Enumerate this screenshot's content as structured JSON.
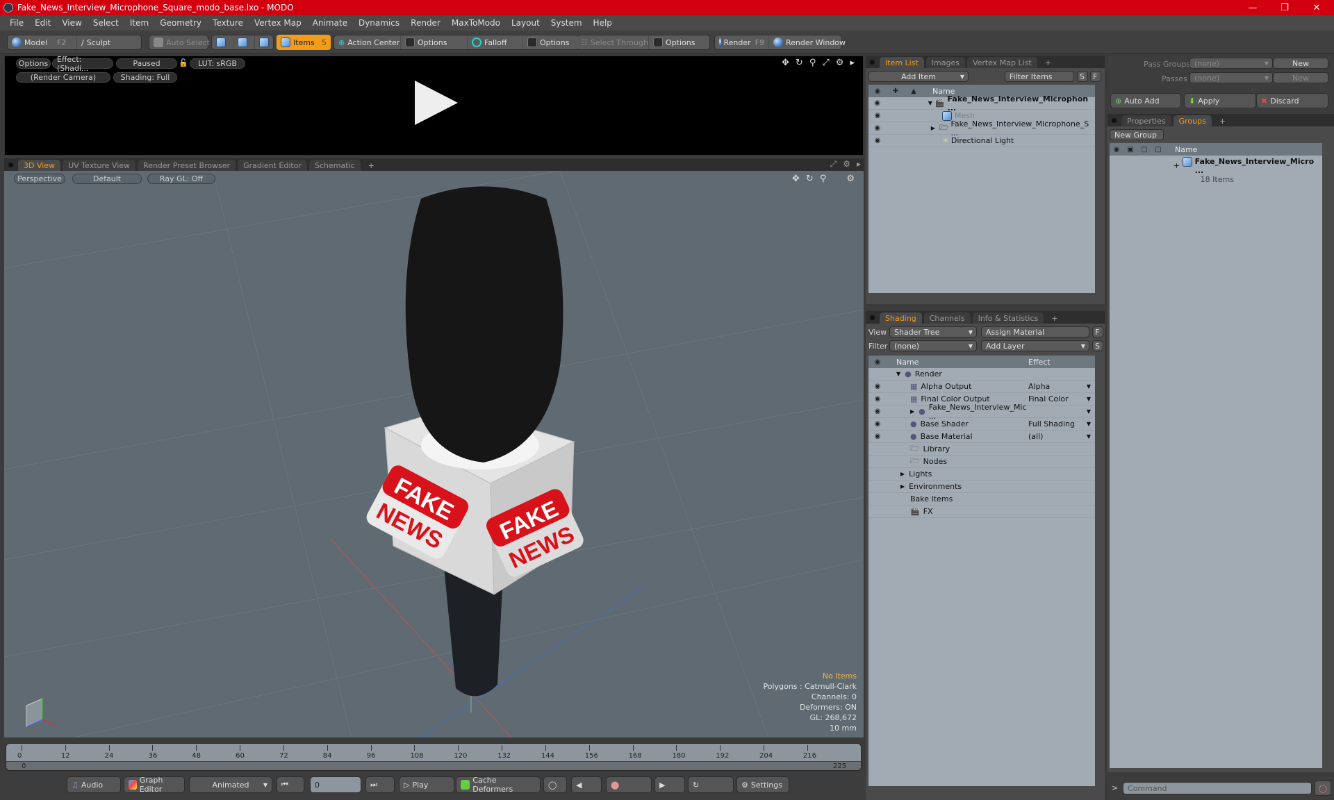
{
  "window": {
    "title": "Fake_News_Interview_Microphone_Square_modo_base.lxo - MODO",
    "accent": "#d2000f"
  },
  "menu": [
    "File",
    "Edit",
    "View",
    "Select",
    "Item",
    "Geometry",
    "Texture",
    "Vertex Map",
    "Animate",
    "Dynamics",
    "Render",
    "MaxToModo",
    "Layout",
    "System",
    "Help"
  ],
  "toolbar": {
    "model": "Model",
    "model_key": "F2",
    "sculpt": "Sculpt",
    "auto_select": "Auto Select",
    "items": "Items",
    "items_key": "5",
    "action_center": "Action Center",
    "options1": "Options",
    "falloff": "Falloff",
    "options2": "Options",
    "select_through": "Select Through",
    "options3": "Options",
    "render": "Render",
    "render_key": "F9",
    "render_window": "Render Window"
  },
  "preview": {
    "options": "Options",
    "effect": "Effect: (Shadi...",
    "status": "Paused",
    "lut": "LUT: sRGB",
    "camera": "(Render Camera)",
    "shading": "Shading: Full"
  },
  "viewport_tabs": [
    "3D View",
    "UV Texture View",
    "Render Preset Browser",
    "Gradient Editor",
    "Schematic",
    "+"
  ],
  "viewport": {
    "projection": "Perspective",
    "style": "Default",
    "raygl": "Ray GL: Off",
    "info": [
      "No Items",
      "Polygons : Catmull-Clark",
      "Channels: 0",
      "Deformers: ON",
      "GL: 268,672",
      "10 mm"
    ],
    "label_text": [
      "FAKE",
      "NEWS"
    ]
  },
  "timeline": {
    "ticks": [
      "0",
      "12",
      "24",
      "36",
      "48",
      "60",
      "72",
      "84",
      "96",
      "108",
      "120",
      "132",
      "144",
      "156",
      "168",
      "180",
      "192",
      "204",
      "216"
    ],
    "start": "0",
    "end": "225",
    "end2": "225"
  },
  "transport": {
    "audio": "Audio",
    "graph_editor": "Graph Editor",
    "mode": "Animated",
    "frame": "0",
    "play": "Play",
    "cache": "Cache Deformers",
    "settings": "Settings"
  },
  "item_list": {
    "tabs": [
      "Item List",
      "Images",
      "Vertex Map List",
      "+"
    ],
    "add_item": "Add Item",
    "filter": "Filter Items",
    "s": "S",
    "f": "F",
    "col_name": "Name",
    "items": [
      {
        "name": "Fake_News_Interview_Microphon ...",
        "bold": true
      },
      {
        "name": "Mesh",
        "dim": true
      },
      {
        "name": "Fake_News_Interview_Microphone_S ..."
      },
      {
        "name": "Directional Light"
      }
    ]
  },
  "shading": {
    "tabs": [
      "Shading",
      "Channels",
      "Info & Statistics",
      "+"
    ],
    "view_label": "View",
    "view_value": "Shader Tree",
    "assign": "Assign Material",
    "f": "F",
    "filter_label": "Filter",
    "filter_value": "(none)",
    "add_layer": "Add Layer",
    "s": "S",
    "col_name": "Name",
    "col_effect": "Effect",
    "rows": [
      {
        "name": "Render",
        "effect": ""
      },
      {
        "name": "Alpha Output",
        "effect": "Alpha"
      },
      {
        "name": "Final Color Output",
        "effect": "Final Color"
      },
      {
        "name": "Fake_News_Interview_Mic ...",
        "effect": ""
      },
      {
        "name": "Base Shader",
        "effect": "Full Shading"
      },
      {
        "name": "Base Material",
        "effect": "(all)"
      },
      {
        "name": "Library",
        "effect": ""
      },
      {
        "name": "Nodes",
        "effect": ""
      },
      {
        "name": "Lights",
        "effect": ""
      },
      {
        "name": "Environments",
        "effect": ""
      },
      {
        "name": "Bake Items",
        "effect": ""
      },
      {
        "name": "FX",
        "effect": ""
      }
    ]
  },
  "passes": {
    "pass_groups": "Pass Groups",
    "passes": "Passes",
    "none1": "(none)",
    "none2": "(none)",
    "new1": "New",
    "new2": "New",
    "auto_add": "Auto Add",
    "apply": "Apply",
    "discard": "Discard"
  },
  "groups": {
    "tabs": [
      "Properties",
      "Groups",
      "+"
    ],
    "new_group": "New Group",
    "col_name": "Name",
    "group_name": "Fake_News_Interview_Micro ...",
    "group_count": "18 Items"
  },
  "command": {
    "prompt": ">",
    "placeholder": "Command"
  }
}
